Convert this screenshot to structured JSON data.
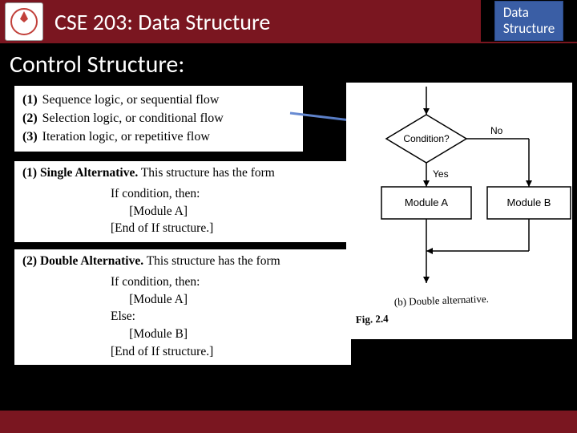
{
  "header": {
    "course_title": "CSE 203: Data Structure",
    "badge_line1": "Data",
    "badge_line2": "Structure"
  },
  "section_title": "Control Structure:",
  "logic_types": [
    {
      "num": "(1)",
      "text": "Sequence logic, or sequential flow"
    },
    {
      "num": "(2)",
      "text": "Selection logic, or conditional flow"
    },
    {
      "num": "(3)",
      "text": "Iteration logic, or repetitive flow"
    }
  ],
  "single_alt": {
    "heading_num": "(1)",
    "heading_bold": "Single Alternative.",
    "heading_rest": " This structure has the form",
    "lines": [
      "If condition, then:",
      "      [Module A]",
      "[End of If structure.]"
    ]
  },
  "double_alt": {
    "heading_num": "(2)",
    "heading_bold": "Double Alternative.",
    "heading_rest": " This structure has the form",
    "lines": [
      "If condition, then:",
      "      [Module A]",
      "Else:",
      "      [Module B]",
      "[End of If structure.]"
    ]
  },
  "diagram": {
    "condition": "Condition?",
    "no": "No",
    "yes": "Yes",
    "module_a": "Module A",
    "module_b": "Module B",
    "caption_prefix": "(b) ",
    "caption_text": "Double alternative.",
    "fig_label": "Fig. 2.4"
  }
}
